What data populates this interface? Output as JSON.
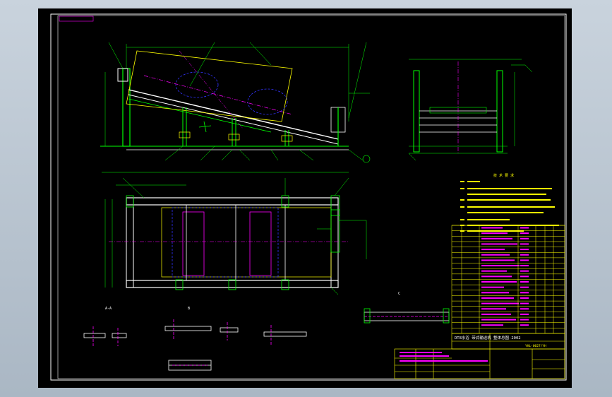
{
  "viewport": {
    "background": "#000000",
    "frame_color": "#ffffff"
  },
  "colors": {
    "line_main": "#00ff00",
    "line_aux": "#ffff00",
    "line_center": "#ff00ff",
    "line_hidden": "#3333ff",
    "line_frame": "#ffffff",
    "text": "#ffff00",
    "text_white": "#ffffff",
    "table_line": "#ffff00",
    "table_cell_fill": "#ff00ff"
  },
  "drawing": {
    "corner_tag": "",
    "title_block": {
      "name": "DT8水浴 带式输送机 整体总图-2002",
      "drawing_no": "YHL-0027/YH"
    },
    "technical_notes_heading": "技 术 要 求",
    "section_labels": [
      "A-A",
      "B",
      "C"
    ]
  },
  "icons": {
    "leaders": "callout-leader-icon",
    "symbol": "section-arrow-icon"
  }
}
